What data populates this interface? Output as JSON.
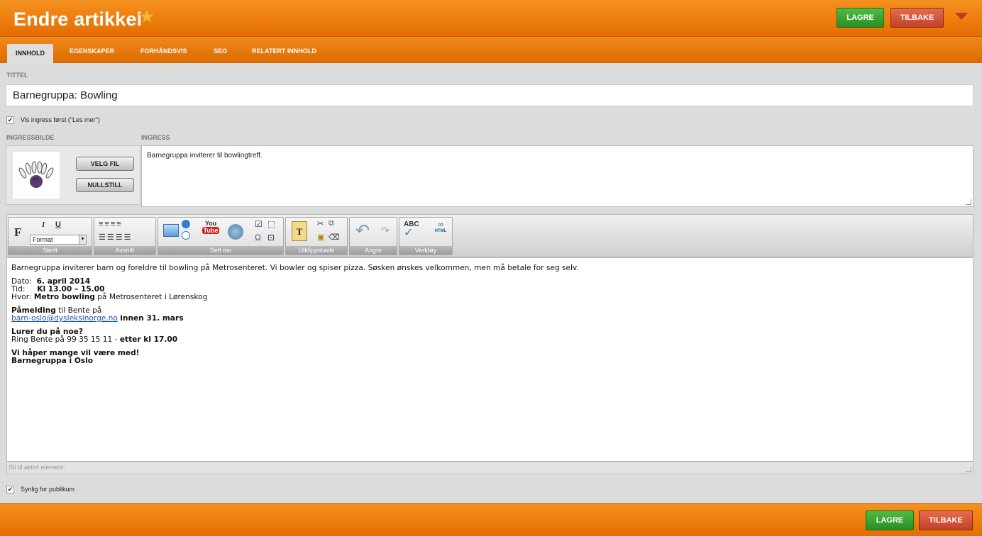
{
  "header": {
    "title": "Endre artikkel",
    "save_label": "LAGRE",
    "back_label": "TILBAKE",
    "accent_color": "#e97a0c"
  },
  "tabs": [
    {
      "label": "INNHOLD",
      "active": true
    },
    {
      "label": "EGENSKAPER",
      "active": false
    },
    {
      "label": "FORHÅNDSVIS",
      "active": false
    },
    {
      "label": "SEO",
      "active": false
    },
    {
      "label": "RELATERT INNHOLD",
      "active": false
    }
  ],
  "form": {
    "title_label": "TITTEL",
    "title_value": "Barnegruppa: Bowling",
    "show_ingress_label": "Vis ingress først (\"Les mer\")",
    "show_ingress_checked": true,
    "ingress_image_label": "INGRESSBILDE",
    "ingress_label": "INGRESS",
    "ingress_value": "Barnegruppa inviterer til bowlingtreff.",
    "choose_file_label": "VELG FIL",
    "reset_label": "NULLSTILL",
    "visible_label": "Synlig for publikum",
    "visible_checked": true
  },
  "toolbar": {
    "groups": [
      "Skrift",
      "Avsnitt",
      "Sett inn",
      "Utklippstavle",
      "Angre",
      "Verktøy"
    ],
    "format_select": "Format",
    "bold_glyph": "F",
    "italic_glyph": "I",
    "underline_glyph": "U",
    "youtube_top": "You",
    "youtube_bottom": "Tube",
    "spell_glyph": "ABC",
    "html_glyph": "HTML"
  },
  "editor": {
    "intro": "Barnegruppa inviterer barn og foreldre til bowling på Metrosenteret. Vi bowler og spiser pizza. Søsken ønskes velkommen, men må betale for seg selv.",
    "date_label": "Dato:",
    "date_value": "6. april 2014",
    "time_label": "Tid:",
    "time_value": "Kl 13.00 – 15.00",
    "place_label": "Hvor:",
    "place_bold": "Metro bowling",
    "place_rest": "på Metrosenteret i Lørenskog",
    "signup_bold": "Påmelding",
    "signup_rest": "til Bente på",
    "email": "barn-oslo@dysleksinorge.no",
    "deadline": "innen 31. mars",
    "question": "Lurer du på noe?",
    "call_text": "Ring Bente på 99 35 15 11 -",
    "call_bold": "etter kl 17.00",
    "closing1": "Vi håper mange vil være med!",
    "closing2": "Barnegruppa i Oslo"
  },
  "path_bar": "Sti til aktivt element:"
}
